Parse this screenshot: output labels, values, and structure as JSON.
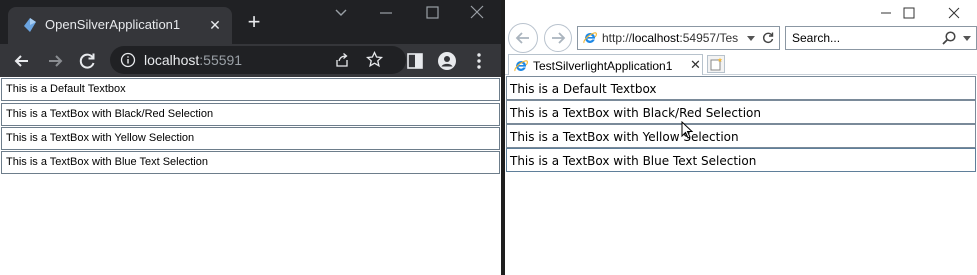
{
  "left_window": {
    "tab": {
      "title": "OpenSilverApplication1",
      "close_glyph": "✕",
      "favicon": "opensilver-icon"
    },
    "new_tab_glyph": "+",
    "omnibox": {
      "host": "localhost",
      "port": ":55591"
    },
    "textboxes": [
      "This is a Default Textbox",
      "This is a TextBox with Black/Red Selection",
      "This is a TextBox with Yellow Selection",
      "This is a TextBox with Blue Text Selection"
    ],
    "colors": {
      "titlebar": "#202124",
      "tab": "#35363a",
      "toolbar": "#35363a",
      "omnibox": "#202124",
      "text": "#e8eaed"
    }
  },
  "right_window": {
    "address": {
      "prefix": "http://",
      "host": "localhost",
      "rest": ":54957/Tes"
    },
    "search": {
      "placeholder": "Search..."
    },
    "tab": {
      "title": "TestSilverlightApplication1",
      "close_glyph": "✕"
    },
    "textboxes": [
      "This is a Default Textbox",
      "This is a TextBox with Black/Red Selection",
      "This is a TextBox with Yellow Selection",
      "This is a TextBox with Blue Text Selection"
    ],
    "colors": {
      "ie_logo": "#1e88e5",
      "border": "#7a8a99"
    }
  }
}
